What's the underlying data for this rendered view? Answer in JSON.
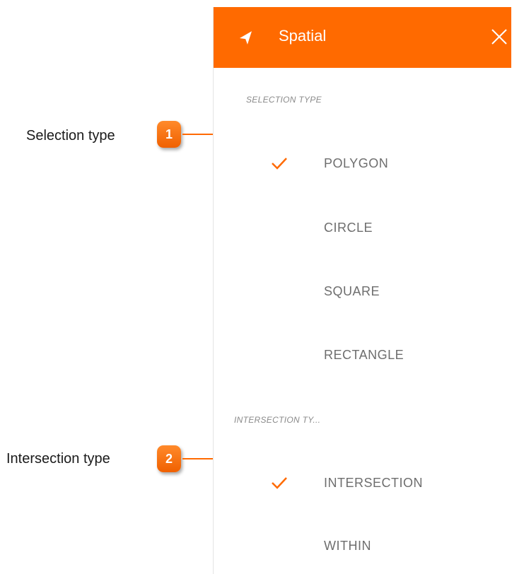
{
  "panel": {
    "title": "Spatial",
    "header_color": "#ff6a00",
    "header_icon": "navigation-arrow-icon",
    "close_icon": "close-icon"
  },
  "selection_type": {
    "label": "SELECTION TYPE",
    "options": [
      {
        "label": "POLYGON",
        "selected": true
      },
      {
        "label": "CIRCLE",
        "selected": false
      },
      {
        "label": "SQUARE",
        "selected": false
      },
      {
        "label": "RECTANGLE",
        "selected": false
      }
    ]
  },
  "intersection_type": {
    "label": "INTERSECTION TY...",
    "options": [
      {
        "label": "INTERSECTION",
        "selected": true
      },
      {
        "label": "WITHIN",
        "selected": false
      }
    ]
  },
  "callouts": [
    {
      "number": "1",
      "text": "Selection type"
    },
    {
      "number": "2",
      "text": "Intersection type"
    }
  ],
  "check_icon": "checkmark-icon",
  "accent_color": "#ff6a00"
}
